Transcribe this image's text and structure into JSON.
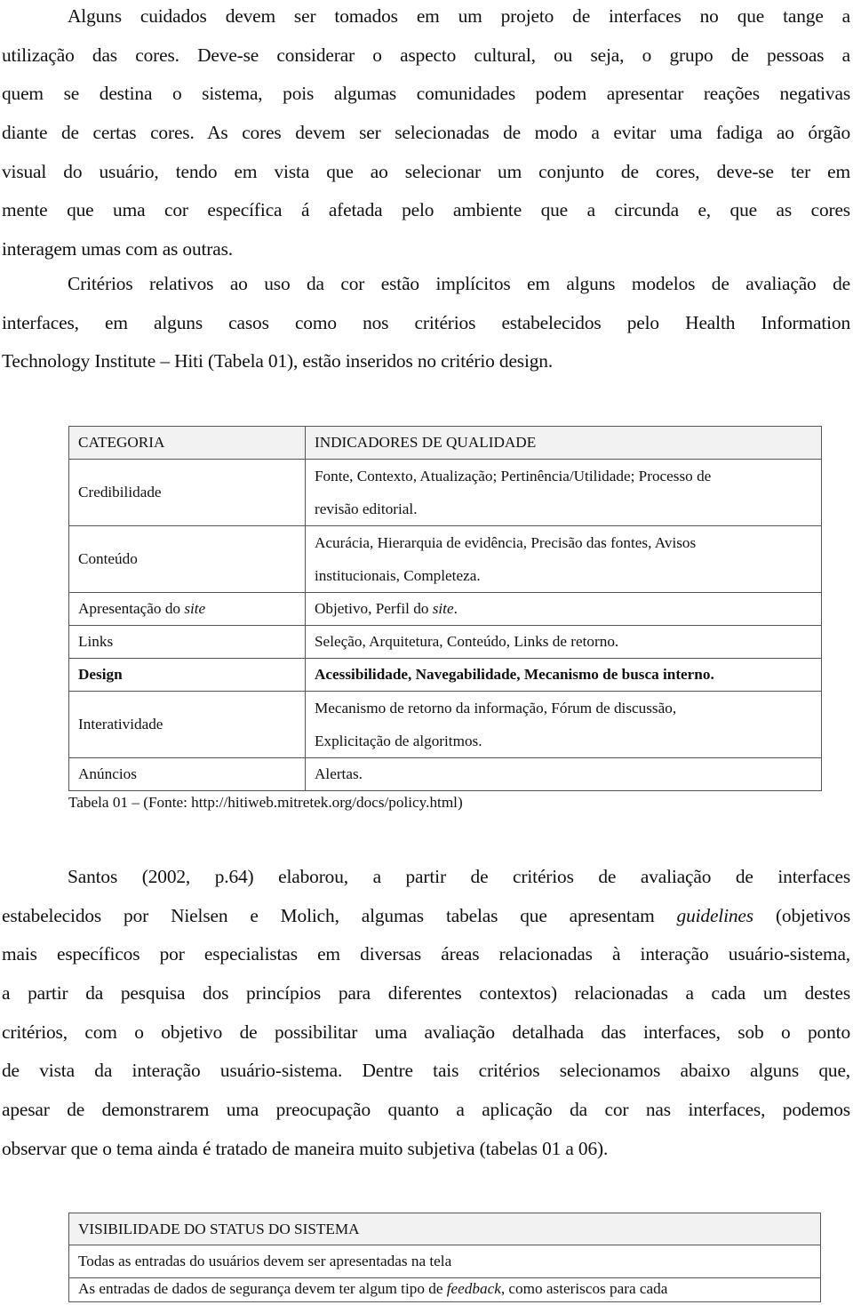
{
  "document": {
    "paragraph_1_lines": [
      "Alguns cuidados devem ser tomados em um projeto de interfaces no que tange a",
      "utilização das cores. Deve-se considerar o aspecto cultural, ou seja, o grupo de pessoas a",
      "quem se destina o sistema, pois algumas comunidades podem apresentar reações negativas",
      "diante de certas cores. As cores devem ser selecionadas de modo a evitar uma fadiga ao órgão",
      "visual do usuário, tendo em vista que ao selecionar um conjunto de cores, deve-se ter em",
      "mente que uma cor específica á afetada pelo ambiente que a circunda e, que as cores",
      "interagem umas com as outras."
    ],
    "paragraph_2_lines": [
      "Critérios relativos ao uso da cor estão implícitos em alguns modelos de avaliação de",
      "interfaces, em alguns casos como nos critérios estabelecidos pelo Health Information",
      "Technology Institute – Hiti (Tabela 01), estão inseridos no critério design."
    ],
    "table_01": {
      "headers": [
        "CATEGORIA",
        "INDICADORES DE QUALIDADE"
      ],
      "rows": [
        {
          "category": "Credibilidade",
          "indicators": [
            "Fonte, Contexto, Atualização; Pertinência/Utilidade; Processo de",
            "revisão editorial."
          ]
        },
        {
          "category": "Conteúdo",
          "indicators": [
            "Acurácia, Hierarquia de evidência, Precisão das fontes, Avisos",
            "institucionais, Completeza."
          ]
        },
        {
          "category_prefix": "Apresentação do ",
          "category_italic": "site",
          "indicators_prefix": "Objetivo, Perfil do ",
          "indicators_italic": "site",
          "indicators_suffix": "."
        },
        {
          "category": "Links",
          "indicators": [
            "Seleção, Arquitetura, Conteúdo, Links de retorno."
          ]
        },
        {
          "category": "Design",
          "indicators": [
            "Acessibilidade, Navegabilidade, Mecanismo de busca interno."
          ],
          "bold": true
        },
        {
          "category": "Interatividade",
          "indicators": [
            "Mecanismo de retorno da informação, Fórum de discussão,",
            "Explicitação de algoritmos."
          ]
        },
        {
          "category": "Anúncios",
          "indicators": [
            "Alertas."
          ]
        }
      ],
      "caption": "Tabela 01 – (Fonte: http://hitiweb.mitretek.org/docs/policy.html)"
    },
    "paragraph_3": {
      "line_1": "Santos (2002, p.64) elaborou, a partir de critérios de avaliação de interfaces",
      "line_2_prefix": "estabelecidos por Nielsen e Molich, algumas tabelas que apresentam ",
      "line_2_italic": "guidelines",
      "line_2_suffix": " (objetivos",
      "lines_rest": [
        "mais específicos por especialistas em diversas áreas relacionadas à interação usuário-sistema,",
        "a partir da pesquisa dos princípios para diferentes contextos) relacionadas a cada um destes",
        "critérios, com o objetivo de possibilitar uma avaliação detalhada das interfaces, sob o ponto",
        "de vista da interação usuário-sistema. Dentre tais critérios selecionamos abaixo alguns que,",
        "apesar de demonstrarem uma preocupação quanto a aplicação da cor nas interfaces, podemos",
        "observar que o tema ainda é tratado de maneira muito subjetiva (tabelas 01 a 06)."
      ]
    },
    "table_02": {
      "header": "VISIBILIDADE DO STATUS DO SISTEMA",
      "row_1": "Todas as entradas do usuários devem ser apresentadas na tela",
      "row_2_prefix": "As entradas de dados de segurança devem ter algum tipo de ",
      "row_2_italic": "feedback",
      "row_2_suffix": ", como asteriscos para cada"
    }
  }
}
